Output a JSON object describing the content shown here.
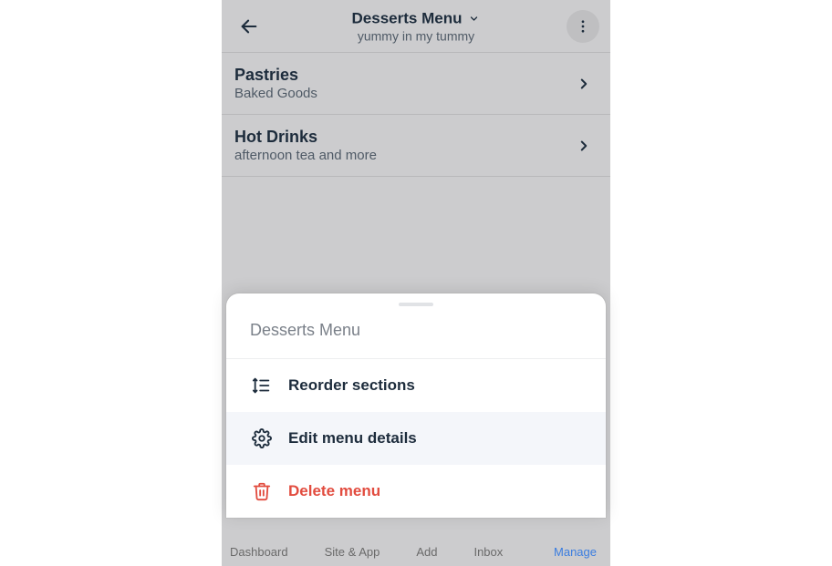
{
  "header": {
    "title": "Desserts Menu",
    "subtitle": "yummy in my tummy"
  },
  "sections": [
    {
      "title": "Pastries",
      "subtitle": "Baked Goods"
    },
    {
      "title": "Hot Drinks",
      "subtitle": "afternoon tea and more"
    }
  ],
  "sheet": {
    "title": "Desserts Menu",
    "items": [
      {
        "label": "Reorder sections"
      },
      {
        "label": "Edit menu details"
      },
      {
        "label": "Delete menu"
      }
    ]
  },
  "bottom_nav": {
    "items": [
      "Dashboard",
      "Site & App",
      "Add",
      "Inbox",
      "Manage"
    ]
  }
}
